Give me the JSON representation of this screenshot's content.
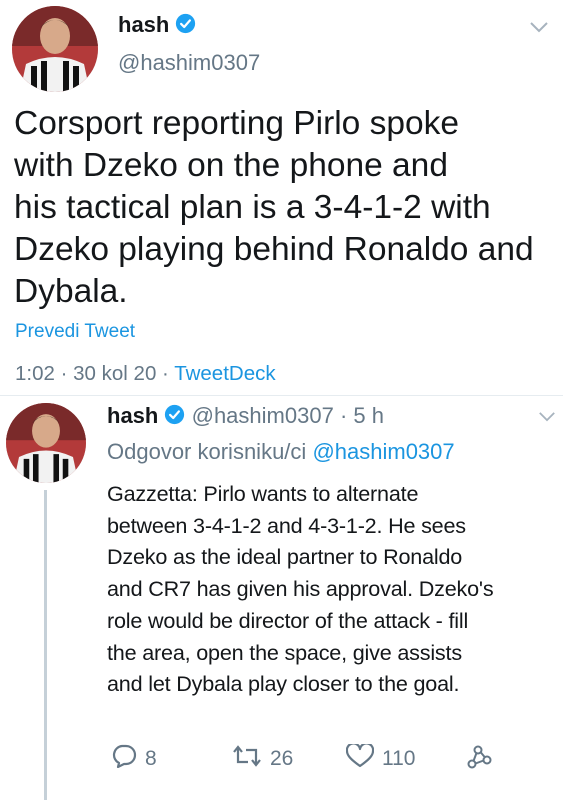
{
  "tweet": {
    "display_name": "hash",
    "handle": "@hashim0307",
    "text_lines": [
      "Corsport reporting Pirlo spoke",
      "with Dzeko on the phone and",
      "his tactical plan is a 3-4-1-2 with",
      "Dzeko playing behind Ronaldo and",
      "Dybala."
    ],
    "translate_label": "Prevedi Tweet",
    "time": "1:02",
    "dot1": "·",
    "date": "30 kol 20",
    "dot2": "·",
    "source": "TweetDeck"
  },
  "reply": {
    "display_name": "hash",
    "handle": "@hashim0307",
    "dot": "·",
    "age": "5 h",
    "replying_prefix": "Odgovor korisniku/ci",
    "replying_to": "@hashim0307",
    "text_lines": [
      "Gazzetta: Pirlo wants to alternate",
      "between 3-4-1-2 and 4-3-1-2. He sees",
      "Dzeko as the ideal partner to Ronaldo",
      "and CR7 has given his approval. Dzeko's",
      "role would be director of the attack - fill",
      "the area, open the space, give assists",
      "and let Dybala play closer to the goal."
    ],
    "actions": {
      "replies": "8",
      "retweets": "26",
      "likes": "110"
    }
  },
  "icons": {
    "verified": "verified-badge-icon",
    "chevron": "chevron-down-icon",
    "reply": "reply-icon",
    "retweet": "retweet-icon",
    "like": "heart-icon",
    "share": "share-icon"
  },
  "colors": {
    "accent": "#1b95e0",
    "muted": "#657786",
    "text": "#14171a"
  }
}
